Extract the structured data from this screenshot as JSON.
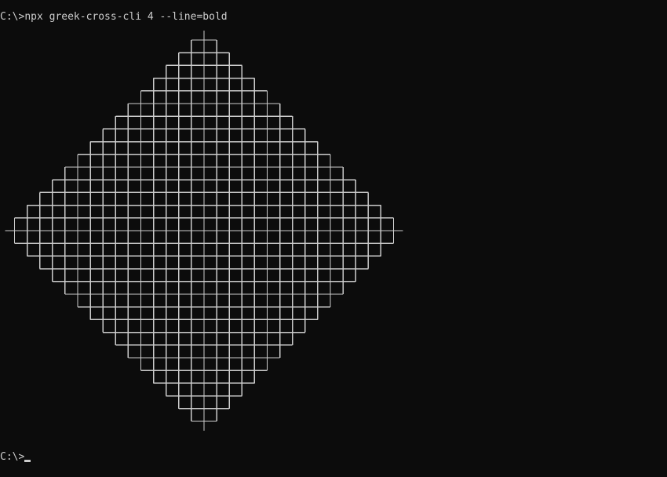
{
  "terminal": {
    "command_prompt": "C:\\>",
    "command_text": "npx greek-cross-cli 4 --line=bold",
    "final_prompt": "C:\\>",
    "background": "#0c0c0c",
    "foreground": "#cccccc"
  }
}
